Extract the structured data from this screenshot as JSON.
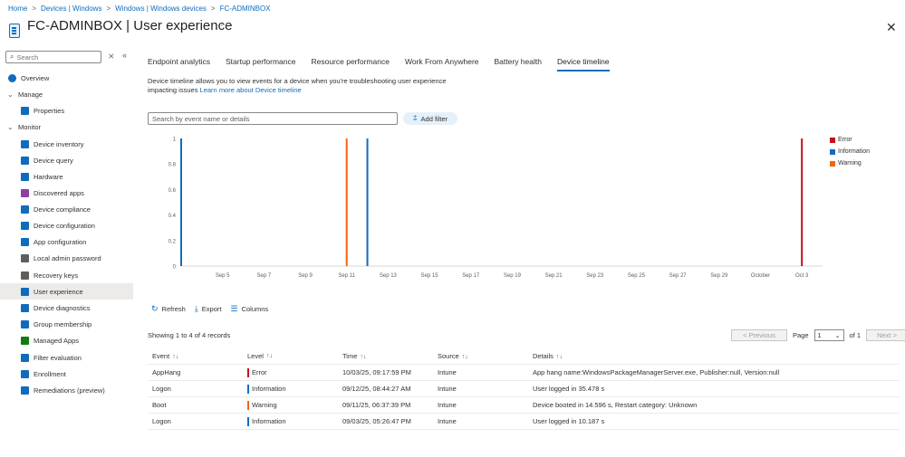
{
  "breadcrumb": [
    "Home",
    "Devices | Windows",
    "Windows | Windows devices",
    "FC-ADMINBOX"
  ],
  "title": "FC-ADMINBOX | User experience",
  "more": "···",
  "close": "✕",
  "sidebar": {
    "search_placeholder": "Search",
    "items": [
      {
        "label": "Overview",
        "type": "link",
        "icon": "info-icon",
        "color": "#0f6cbd"
      },
      {
        "label": "Manage",
        "type": "section"
      },
      {
        "label": "Properties",
        "type": "link",
        "icon": "properties-icon",
        "color": "#0f6cbd"
      },
      {
        "label": "Monitor",
        "type": "section"
      },
      {
        "label": "Device inventory",
        "type": "link",
        "icon": "inventory-icon",
        "color": "#0f6cbd"
      },
      {
        "label": "Device query",
        "type": "link",
        "icon": "query-icon",
        "color": "#0f6cbd"
      },
      {
        "label": "Hardware",
        "type": "link",
        "icon": "hardware-icon",
        "color": "#0f6cbd"
      },
      {
        "label": "Discovered apps",
        "type": "link",
        "icon": "apps-icon",
        "color": "#8a3fa7"
      },
      {
        "label": "Device compliance",
        "type": "link",
        "icon": "compliance-icon",
        "color": "#0f6cbd"
      },
      {
        "label": "Device configuration",
        "type": "link",
        "icon": "configuration-icon",
        "color": "#0f6cbd"
      },
      {
        "label": "App configuration",
        "type": "link",
        "icon": "app-config-icon",
        "color": "#0f6cbd"
      },
      {
        "label": "Local admin password",
        "type": "link",
        "icon": "password-icon",
        "color": "#605e5c"
      },
      {
        "label": "Recovery keys",
        "type": "link",
        "icon": "key-icon",
        "color": "#605e5c"
      },
      {
        "label": "User experience",
        "type": "link",
        "icon": "user-experience-icon",
        "color": "#0f6cbd",
        "active": true
      },
      {
        "label": "Device diagnostics",
        "type": "link",
        "icon": "diagnostics-icon",
        "color": "#0f6cbd"
      },
      {
        "label": "Group membership",
        "type": "link",
        "icon": "group-icon",
        "color": "#0f6cbd"
      },
      {
        "label": "Managed Apps",
        "type": "link",
        "icon": "managed-apps-icon",
        "color": "#107c10"
      },
      {
        "label": "Filter evaluation",
        "type": "link",
        "icon": "filter-icon",
        "color": "#0f6cbd"
      },
      {
        "label": "Enrollment",
        "type": "link",
        "icon": "enrollment-icon",
        "color": "#0f6cbd"
      },
      {
        "label": "Remediations (preview)",
        "type": "link",
        "icon": "remediation-icon",
        "color": "#0f6cbd"
      }
    ]
  },
  "tabs": [
    {
      "label": "Endpoint analytics"
    },
    {
      "label": "Startup performance"
    },
    {
      "label": "Resource performance"
    },
    {
      "label": "Work From Anywhere"
    },
    {
      "label": "Battery health"
    },
    {
      "label": "Device timeline",
      "active": true
    }
  ],
  "description": {
    "text": "Device timeline allows you to view events for a device when you're troubleshooting user experience impacting issues",
    "link": "Learn more about Device timeline"
  },
  "event_search_placeholder": "Search by event name or details",
  "add_filter_label": "Add filter",
  "chart_data": {
    "type": "bar",
    "x_ticks": [
      "Sep 5",
      "Sep 7",
      "Sep 9",
      "Sep 11",
      "Sep 13",
      "Sep 15",
      "Sep 17",
      "Sep 19",
      "Sep 21",
      "Sep 23",
      "Sep 25",
      "Sep 27",
      "Sep 29",
      "October",
      "Oct 3"
    ],
    "y_ticks": [
      "0",
      "0.2",
      "0.4",
      "0.6",
      "0.8",
      "1"
    ],
    "ylim": [
      0,
      1
    ],
    "xlim_days": [
      3,
      34
    ],
    "series": [
      {
        "name": "Error",
        "color": "#c50f1f",
        "events": [
          {
            "date": "10/03/25",
            "value": 1
          }
        ]
      },
      {
        "name": "Information",
        "color": "#0f6cbd",
        "events": [
          {
            "date": "09/03/25",
            "value": 1
          },
          {
            "date": "09/12/25",
            "value": 1
          }
        ]
      },
      {
        "name": "Warning",
        "color": "#f7630c",
        "events": [
          {
            "date": "09/11/25",
            "value": 1
          }
        ]
      }
    ],
    "legend_position": "right"
  },
  "toolbar": {
    "refresh": "Refresh",
    "export": "Export",
    "columns": "Columns"
  },
  "records_summary": "Showing 1 to 4 of 4 records",
  "pager": {
    "previous": "< Previous",
    "page_label": "Page",
    "page": "1",
    "of": "of 1",
    "next": "Next >"
  },
  "table": {
    "headers": [
      "Event",
      "Level",
      "Time",
      "Source",
      "Details"
    ],
    "rows": [
      {
        "event": "AppHang",
        "level": "Error",
        "level_color": "#c50f1f",
        "time": "10/03/25, 09:17:59 PM",
        "source": "Intune",
        "details": "App hang name:WindowsPackageManagerServer.exe, Publisher:null, Version:null"
      },
      {
        "event": "Logon",
        "level": "Information",
        "level_color": "#0f6cbd",
        "time": "09/12/25, 08:44:27 AM",
        "source": "Intune",
        "details": "User logged in 35.478 s"
      },
      {
        "event": "Boot",
        "level": "Warning",
        "level_color": "#f7630c",
        "time": "09/11/25, 06:37:39 PM",
        "source": "Intune",
        "details": "Device booted in 14.596 s, Restart category: Unknown"
      },
      {
        "event": "Logon",
        "level": "Information",
        "level_color": "#0f6cbd",
        "time": "09/03/25, 05:26:47 PM",
        "source": "Intune",
        "details": "User logged in 10.187 s"
      }
    ]
  }
}
